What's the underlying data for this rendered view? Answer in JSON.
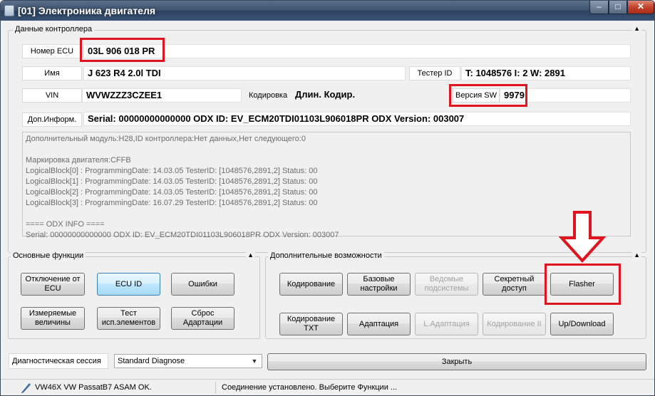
{
  "window": {
    "title": "[01] Электроника двигателя",
    "minimize": "–",
    "maximize": "□",
    "close": "✕"
  },
  "controller": {
    "legend": "Данные контроллера",
    "ecu_label": "Номер ECU",
    "ecu_value": "03L 906 018 PR",
    "name_label": "Имя",
    "name_value": "J 623 R4 2.0l TDI",
    "tester_label": "Тестер ID",
    "tester_value": "T: 1048576 I: 2 W: 2891",
    "vin_label": "VIN",
    "vin_value": "WVWZZZ3CZEE1",
    "coding_label": "Кодировка",
    "coding_value": "Длин. Кодир.",
    "sw_label": "Версия SW",
    "sw_value": "9979",
    "extra_label": "Доп.Информ.",
    "extra_value": "Serial: 00000000000000 ODX ID: EV_ECM20TDI01103L906018PR ODX Version: 003007",
    "info_lines": [
      "Дополнительный модуль:H28,ID контроллера:Нет данных,Нет следующего:0",
      "",
      "Маркировка двигателя:CFFB",
      "LogicalBlock[0] : ProgrammingDate: 14.03.05 TesterID: [1048576,2891,2] Status: 00",
      "LogicalBlock[1] : ProgrammingDate: 14.03.05 TesterID: [1048576,2891,2] Status: 00",
      "LogicalBlock[2] : ProgrammingDate: 14.03.05 TesterID: [1048576,2891,2] Status: 00",
      "LogicalBlock[3] : ProgrammingDate: 16.07.29 TesterID: [1048576,2891,2] Status: 00",
      "",
      "====  ODX INFO ====",
      "Serial: 00000000000000 ODX ID: EV_ECM20TDI01103L906018PR ODX Version: 003007"
    ]
  },
  "basic": {
    "legend": "Основные функции",
    "buttons": [
      "Отключение от\nECU",
      "ECU ID",
      "Ошибки",
      "Измеряемые\nвеличины",
      "Тест\nисп.элементов",
      "Сброс\nАдартации"
    ]
  },
  "extra": {
    "legend": "Дополнительные возможности",
    "buttons": [
      "Кодирование",
      "Базовые\nнастройки",
      "Ведомые\nподсистемы",
      "Секретный\nдоступ",
      "Flasher",
      "Кодирование\nTXT",
      "Адаптация",
      "L.Адаптация",
      "Кодирование II",
      "Up/Download"
    ]
  },
  "session": {
    "label": "Диагностическая сессия",
    "value": "Standard Diagnose"
  },
  "close_button": "Закрыть",
  "status": {
    "left": "VW46X VW PassatB7 ASAM OK.",
    "right": "Соединение установлено. Выберите Функции ..."
  },
  "group_arrow": "▲",
  "select_arrow": "▼",
  "colors": {
    "highlight": "#e0141e",
    "active_button": "#bee6fd",
    "title_bar": "#3d526d"
  },
  "icons": {
    "status": "feather-pen-icon",
    "arrow": "down-arrow-annotation-icon"
  }
}
